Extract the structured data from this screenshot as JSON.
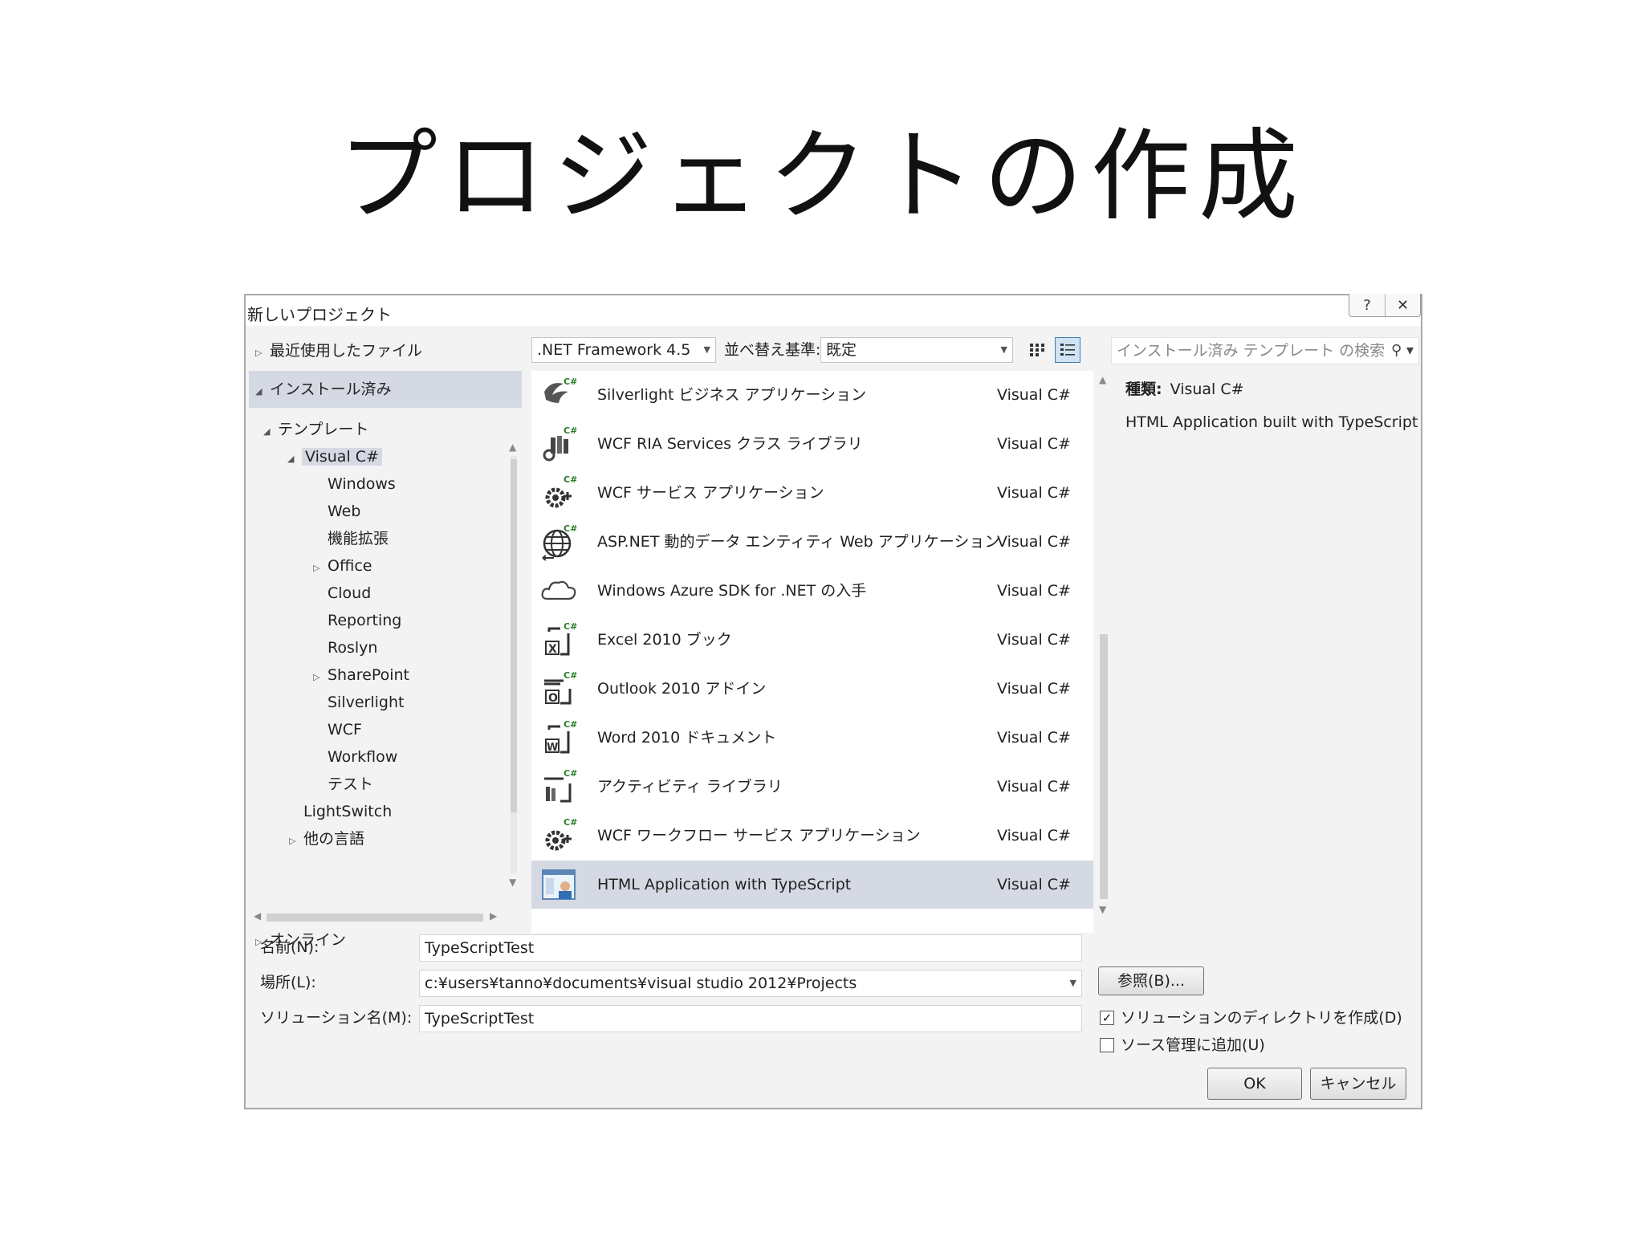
{
  "slide": {
    "title": "プロジェクトの作成"
  },
  "dialog": {
    "title": "新しいプロジェクト",
    "help_glyph": "?",
    "close_glyph": "✕"
  },
  "tree": {
    "recent": "最近使用したファイル",
    "installed": "インストール済み",
    "templates": "テンプレート",
    "visual_csharp": "Visual C#",
    "children": [
      "Windows",
      "Web",
      "機能拡張",
      "Office",
      "Cloud",
      "Reporting",
      "Roslyn",
      "SharePoint",
      "Silverlight",
      "WCF",
      "Workflow",
      "テスト"
    ],
    "lightswitch": "LightSwitch",
    "other_languages": "他の言語",
    "online": "オンライン"
  },
  "toolbar": {
    "framework": ".NET Framework 4.5",
    "sort_label": "並べ替え基準:",
    "sort_value": "既定",
    "search_placeholder": "インストール済み テンプレート の検索"
  },
  "templates": [
    {
      "name": "Silverlight ビジネス アプリケーション",
      "lang": "Visual C#",
      "icon": "silverlight-icon"
    },
    {
      "name": "WCF RIA Services クラス ライブラリ",
      "lang": "Visual C#",
      "icon": "ria-library-icon"
    },
    {
      "name": "WCF サービス アプリケーション",
      "lang": "Visual C#",
      "icon": "wcf-gear-icon"
    },
    {
      "name": "ASP.NET 動的データ エンティティ Web アプリケーション",
      "lang": "Visual C#",
      "icon": "globe-icon"
    },
    {
      "name": "Windows Azure SDK for .NET の入手",
      "lang": "Visual C#",
      "icon": "cloud-icon"
    },
    {
      "name": "Excel 2010 ブック",
      "lang": "Visual C#",
      "icon": "excel-icon"
    },
    {
      "name": "Outlook 2010 アドイン",
      "lang": "Visual C#",
      "icon": "outlook-icon"
    },
    {
      "name": "Word 2010 ドキュメント",
      "lang": "Visual C#",
      "icon": "word-icon"
    },
    {
      "name": "アクティビティ ライブラリ",
      "lang": "Visual C#",
      "icon": "activity-library-icon"
    },
    {
      "name": "WCF ワークフロー サービス アプリケーション",
      "lang": "Visual C#",
      "icon": "workflow-gear-icon"
    },
    {
      "name": "HTML Application with TypeScript",
      "lang": "Visual C#",
      "icon": "html-typescript-icon"
    }
  ],
  "details": {
    "kind_label": "種類:",
    "kind_value": "Visual C#",
    "description": "HTML Application built with TypeScript"
  },
  "form": {
    "name_label": "名前(N):",
    "name_value": "TypeScriptTest",
    "location_label": "場所(L):",
    "location_value": "c:¥users¥tanno¥documents¥visual studio 2012¥Projects",
    "solution_label": "ソリューション名(M):",
    "solution_value": "TypeScriptTest",
    "browse_button": "参照(B)...",
    "create_dir_label": "ソリューションのディレクトリを作成(D)",
    "create_dir_checked": true,
    "source_control_label": "ソース管理に追加(U)",
    "source_control_checked": false,
    "ok_button": "OK",
    "cancel_button": "キャンセル"
  },
  "colors": {
    "selection": "#d5d9e3",
    "dialog_bg": "#f3f3f3",
    "accent": "#3c7fb1"
  }
}
